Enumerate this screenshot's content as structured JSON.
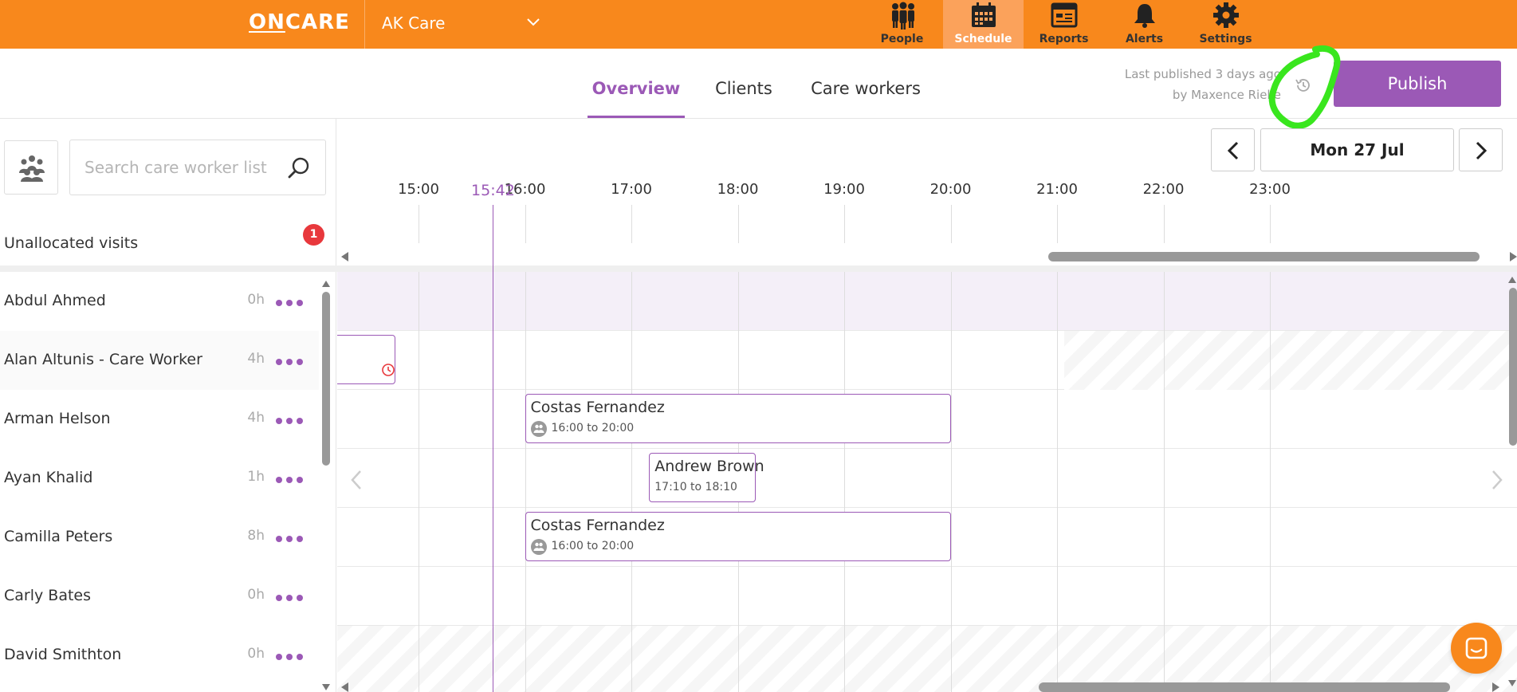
{
  "header": {
    "logo_prefix": "ON",
    "logo_suffix": "CARE",
    "org": "AK Care",
    "nav": [
      {
        "label": "People",
        "icon": "people-icon"
      },
      {
        "label": "Schedule",
        "icon": "calendar-icon",
        "active": true
      },
      {
        "label": "Reports",
        "icon": "reports-icon"
      },
      {
        "label": "Alerts",
        "icon": "bell-icon"
      },
      {
        "label": "Settings",
        "icon": "gear-icon"
      }
    ]
  },
  "tabs": {
    "overview": "Overview",
    "clients": "Clients",
    "care_workers": "Care workers",
    "active": "Overview"
  },
  "publish": {
    "last_published": "Last published 3 days ago",
    "by": "by Maxence Rielle",
    "button": "Publish"
  },
  "sidebar": {
    "search_placeholder": "Search care worker list",
    "unallocated_label": "Unallocated visits",
    "unallocated_count": "1",
    "workers": [
      {
        "name": "Abdul Ahmed",
        "hours": "0h"
      },
      {
        "name": "Alan Altunis - Care Worker",
        "hours": "4h"
      },
      {
        "name": "Arman Helson",
        "hours": "4h"
      },
      {
        "name": "Ayan Khalid",
        "hours": "1h"
      },
      {
        "name": "Camilla Peters",
        "hours": "8h"
      },
      {
        "name": "Carly Bates",
        "hours": "0h"
      },
      {
        "name": "David Smithton",
        "hours": "0h"
      }
    ]
  },
  "timeline": {
    "date": "Mon 27 Jul",
    "now": "15:42",
    "hours": [
      "15:00",
      "16:00",
      "17:00",
      "18:00",
      "19:00",
      "20:00",
      "21:00",
      "22:00",
      "23:00"
    ],
    "visits": [
      {
        "row": 2,
        "client": "Costas Fernandez",
        "time": "16:00 to 20:00",
        "group": true
      },
      {
        "row": 3,
        "client": "Andrew Brown",
        "time": "17:10 to 18:10",
        "group": false
      },
      {
        "row": 4,
        "client": "Costas Fernandez",
        "time": "16:00 to 20:00",
        "group": true
      }
    ]
  },
  "colors": {
    "brand": "#f8881c",
    "accent": "#9b59b6",
    "alert": "#e8383c"
  }
}
